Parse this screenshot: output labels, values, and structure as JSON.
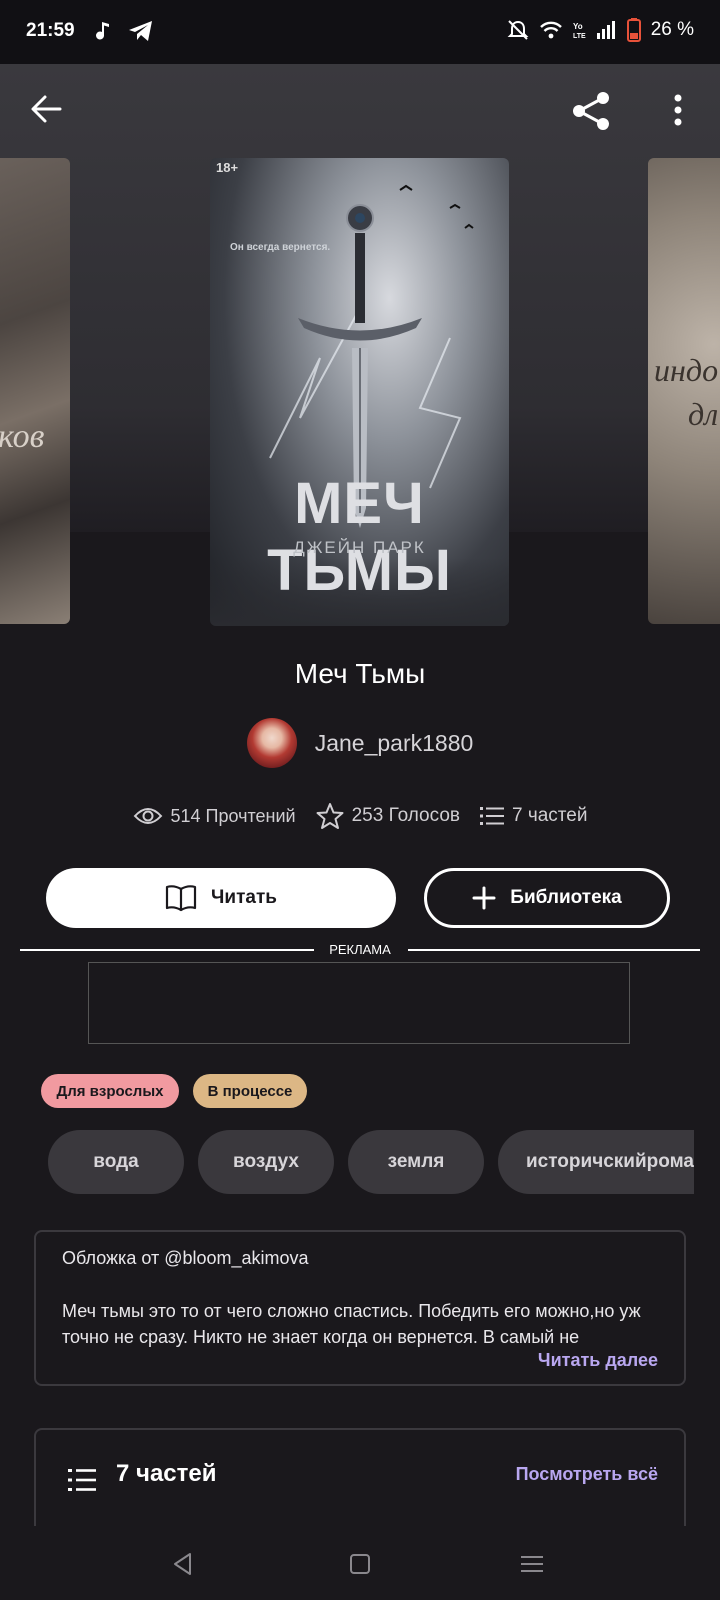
{
  "status_bar": {
    "time": "21:59",
    "battery": "26 %",
    "icons": [
      "music-note-icon",
      "telegram-icon",
      "bell-off-icon",
      "wifi-icon",
      "volte-icon",
      "signal-icon",
      "battery-icon"
    ]
  },
  "toolbar": {
    "back_icon": "arrow-left-icon",
    "share_icon": "share-icon",
    "more_icon": "more-vertical-icon"
  },
  "covers": {
    "left_text": "ков",
    "right_text_1": "индо",
    "right_text_2": "дл",
    "main": {
      "age_label": "18+",
      "tagline": "Он всегда вернется.",
      "title": "МЕЧ ТЬМЫ",
      "author": "ДЖЕЙН ПАРК"
    }
  },
  "book": {
    "title": "Меч Тьмы",
    "author": "Jane_park1880",
    "reads": "514 Прочтений",
    "votes": "253 Голосов",
    "parts": "7 частей"
  },
  "actions": {
    "read_label": "Читать",
    "library_label": "Библиотека"
  },
  "ad": {
    "label": "РЕКЛАМА"
  },
  "badges": {
    "adult": "Для взрослых",
    "status": "В процессе"
  },
  "tags": [
    "вода",
    "воздух",
    "земля",
    "историчскийроман"
  ],
  "description": {
    "cover_credit": "Обложка от @bloom_akimova",
    "text": "Меч тьмы это то от чего сложно спастись. Победить его можно,но уж точно не сразу. Никто не знает когда он вернется. В самый не",
    "read_more": "Читать далее"
  },
  "parts_section": {
    "title": "7 частей",
    "view_all": "Посмотреть всё"
  },
  "colors": {
    "background": "#1a181c",
    "accent": "#b9a7f0",
    "adult_badge": "#f19aa0",
    "status_badge": "#dcb785"
  }
}
